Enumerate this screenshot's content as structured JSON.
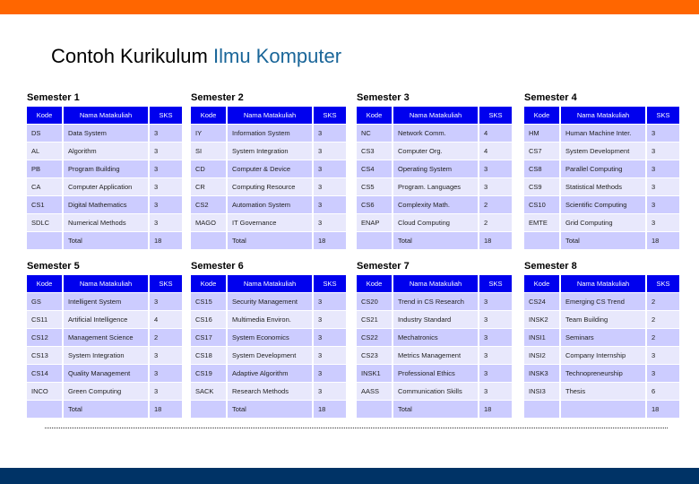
{
  "title": {
    "main": "Contoh Kurikulum",
    "accent": "Ilmu Komputer"
  },
  "colors": {
    "top_bar": "#ff6600",
    "bottom_bar": "#003366",
    "header_bg": "#0000ee",
    "row_odd": "#ccccff",
    "row_even": "#e8e8fc",
    "title_accent": "#1a6699"
  },
  "columns": {
    "kode": "Kode",
    "nama": "Nama Matakuliah",
    "sks": "SKS"
  },
  "semesters": [
    {
      "label": "Semester 1",
      "courses": [
        {
          "kode": "DS",
          "nama": "Data System",
          "sks": "3"
        },
        {
          "kode": "AL",
          "nama": "Algorithm",
          "sks": "3"
        },
        {
          "kode": "PB",
          "nama": "Program Building",
          "sks": "3"
        },
        {
          "kode": "CA",
          "nama": "Computer Application",
          "sks": "3"
        },
        {
          "kode": "CS1",
          "nama": "Digital Mathematics",
          "sks": "3"
        },
        {
          "kode": "SDLC",
          "nama": "Numerical Methods",
          "sks": "3"
        }
      ],
      "total_label": "Total",
      "total": "18"
    },
    {
      "label": "Semester 2",
      "courses": [
        {
          "kode": "IY",
          "nama": "Information System",
          "sks": "3"
        },
        {
          "kode": "SI",
          "nama": "System Integration",
          "sks": "3"
        },
        {
          "kode": "CD",
          "nama": "Computer & Device",
          "sks": "3"
        },
        {
          "kode": "CR",
          "nama": "Computing Resource",
          "sks": "3"
        },
        {
          "kode": "CS2",
          "nama": "Automation System",
          "sks": "3"
        },
        {
          "kode": "MAGO",
          "nama": "IT Governance",
          "sks": "3"
        }
      ],
      "total_label": "Total",
      "total": "18"
    },
    {
      "label": "Semester 3",
      "courses": [
        {
          "kode": "NC",
          "nama": "Network Comm.",
          "sks": "4"
        },
        {
          "kode": "CS3",
          "nama": "Computer Org.",
          "sks": "4"
        },
        {
          "kode": "CS4",
          "nama": "Operating System",
          "sks": "3"
        },
        {
          "kode": "CS5",
          "nama": "Program. Languages",
          "sks": "3"
        },
        {
          "kode": "CS6",
          "nama": "Complexity Math.",
          "sks": "2"
        },
        {
          "kode": "ENAP",
          "nama": "Cloud Computing",
          "sks": "2"
        }
      ],
      "total_label": "Total",
      "total": "18"
    },
    {
      "label": "Semester 4",
      "courses": [
        {
          "kode": "HM",
          "nama": "Human Machine Inter.",
          "sks": "3"
        },
        {
          "kode": "CS7",
          "nama": "System Development",
          "sks": "3"
        },
        {
          "kode": "CS8",
          "nama": "Parallel Computing",
          "sks": "3"
        },
        {
          "kode": "CS9",
          "nama": "Statistical Methods",
          "sks": "3"
        },
        {
          "kode": "CS10",
          "nama": "Scientific Computing",
          "sks": "3"
        },
        {
          "kode": "EMTE",
          "nama": "Grid Computing",
          "sks": "3"
        }
      ],
      "total_label": "Total",
      "total": "18"
    },
    {
      "label": "Semester 5",
      "courses": [
        {
          "kode": "GS",
          "nama": "Intelligent System",
          "sks": "3"
        },
        {
          "kode": "CS11",
          "nama": "Artificial Intelligence",
          "sks": "4"
        },
        {
          "kode": "CS12",
          "nama": "Management Science",
          "sks": "2"
        },
        {
          "kode": "CS13",
          "nama": "System Integration",
          "sks": "3"
        },
        {
          "kode": "CS14",
          "nama": "Quality Management",
          "sks": "3"
        },
        {
          "kode": "INCO",
          "nama": "Green Computing",
          "sks": "3"
        }
      ],
      "total_label": "Total",
      "total": "18"
    },
    {
      "label": "Semester 6",
      "courses": [
        {
          "kode": "CS15",
          "nama": "Security Management",
          "sks": "3"
        },
        {
          "kode": "CS16",
          "nama": "Multimedia Environ.",
          "sks": "3"
        },
        {
          "kode": "CS17",
          "nama": "System Economics",
          "sks": "3"
        },
        {
          "kode": "CS18",
          "nama": "System Development",
          "sks": "3"
        },
        {
          "kode": "CS19",
          "nama": "Adaptive Algorithm",
          "sks": "3"
        },
        {
          "kode": "SACK",
          "nama": "Research Methods",
          "sks": "3"
        }
      ],
      "total_label": "Total",
      "total": "18"
    },
    {
      "label": "Semester 7",
      "courses": [
        {
          "kode": "CS20",
          "nama": "Trend in CS Research",
          "sks": "3"
        },
        {
          "kode": "CS21",
          "nama": "Industry Standard",
          "sks": "3"
        },
        {
          "kode": "CS22",
          "nama": "Mechatronics",
          "sks": "3"
        },
        {
          "kode": "CS23",
          "nama": "Metrics Management",
          "sks": "3"
        },
        {
          "kode": "INSK1",
          "nama": "Professional Ethics",
          "sks": "3"
        },
        {
          "kode": "AASS",
          "nama": "Communication Skills",
          "sks": "3"
        }
      ],
      "total_label": "Total",
      "total": "18"
    },
    {
      "label": "Semester 8",
      "courses": [
        {
          "kode": "CS24",
          "nama": "Emerging CS Trend",
          "sks": "2"
        },
        {
          "kode": "INSK2",
          "nama": "Team Building",
          "sks": "2"
        },
        {
          "kode": "INSI1",
          "nama": "Seminars",
          "sks": "2"
        },
        {
          "kode": "INSI2",
          "nama": "Company Internship",
          "sks": "3"
        },
        {
          "kode": "INSK3",
          "nama": "Technopreneurship",
          "sks": "3"
        },
        {
          "kode": "INSI3",
          "nama": "Thesis",
          "sks": "6"
        }
      ],
      "total_label": "",
      "total": "18"
    }
  ]
}
